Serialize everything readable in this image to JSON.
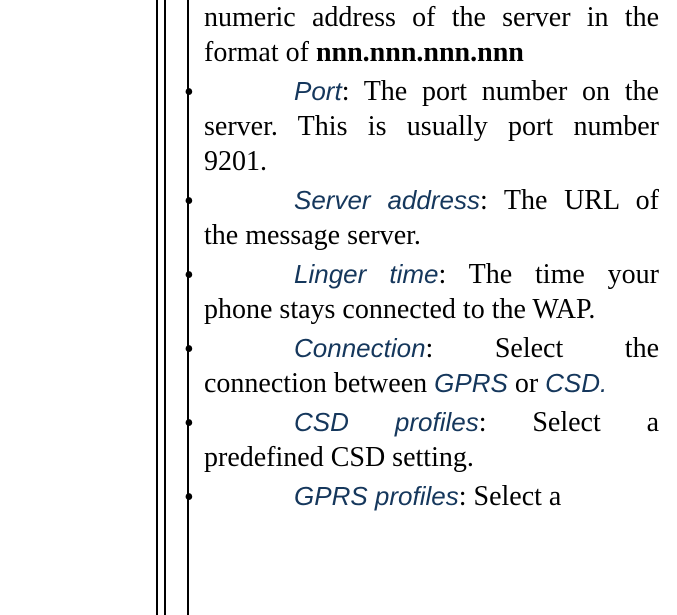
{
  "intro": {
    "line1": "numeric address of the server in",
    "line2_pre": "the format of ",
    "line2_bold": "nnn.nnn.nnn.nnn"
  },
  "items": [
    {
      "term": "Port",
      "after_term": ": The port number",
      "rest": "on the server. This is usually port number 9201."
    },
    {
      "term": "Server address",
      "after_term": ": The",
      "rest": "URL of the message server."
    },
    {
      "term": "Linger time",
      "after_term": ": The time",
      "rest": "your phone stays connected to the WAP."
    },
    {
      "term": "Connection",
      "after_term": ": Select the",
      "rest_pre": "connection between ",
      "inline1": "GPRS",
      "rest_mid": " or ",
      "inline2": "CSD."
    },
    {
      "term": "CSD profiles",
      "after_term": ": Select a",
      "rest": "predefined CSD setting."
    },
    {
      "term": "GPRS profiles",
      "after_term": ": Select a",
      "rest": ""
    }
  ]
}
